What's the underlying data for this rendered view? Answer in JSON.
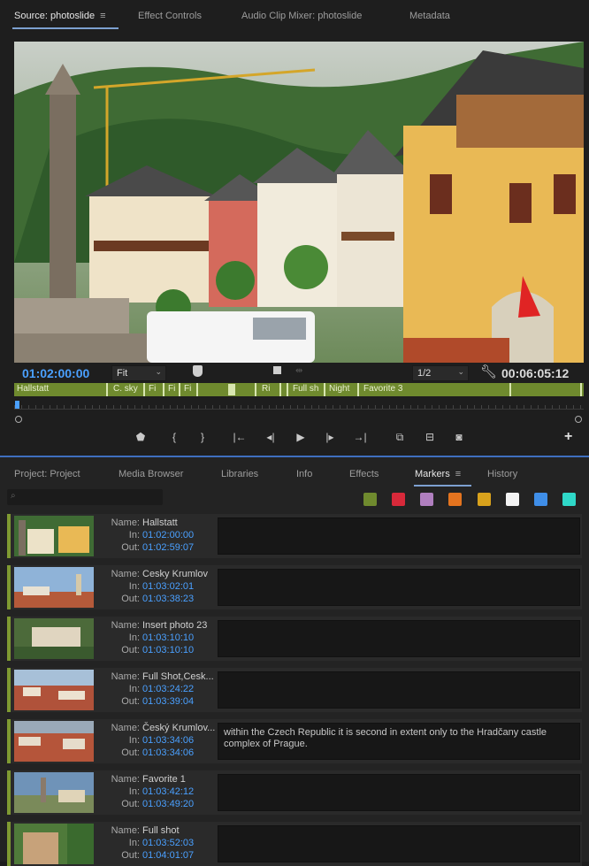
{
  "source_tabs": [
    {
      "label": "Source: photoslide",
      "active": true
    },
    {
      "label": "Effect Controls"
    },
    {
      "label": "Audio Clip Mixer: photoslide"
    },
    {
      "label": "Metadata"
    }
  ],
  "monitor": {
    "current_timecode": "01:02:00:00",
    "zoom": "Fit",
    "resolution": "1/2",
    "duration_timecode": "00:06:05:12"
  },
  "clip_markers": [
    "Hallstatt",
    "C. sky",
    "Fi",
    "Fi",
    "Fi",
    "Ri",
    "Full sh",
    "Night",
    "Favorite 3"
  ],
  "project_tabs": [
    {
      "label": "Project: Project"
    },
    {
      "label": "Media Browser"
    },
    {
      "label": "Libraries"
    },
    {
      "label": "Info"
    },
    {
      "label": "Effects"
    },
    {
      "label": "Markers",
      "active": true
    },
    {
      "label": "History"
    }
  ],
  "marker_colors": [
    "#6f8a2e",
    "#d8293a",
    "#b07fbf",
    "#e4741f",
    "#d9a21c",
    "#f2f2f2",
    "#3f8ee8",
    "#2fd8c8"
  ],
  "labels": {
    "name": "Name:",
    "in": "In:",
    "out": "Out:"
  },
  "markers": [
    {
      "name": "Hallstatt",
      "in": "01:02:00:00",
      "out": "01:02:59:07",
      "comment": ""
    },
    {
      "name": "Cesky Krumlov",
      "in": "01:03:02:01",
      "out": "01:03:38:23",
      "comment": ""
    },
    {
      "name": "Insert photo 23",
      "in": "01:03:10:10",
      "out": "01:03:10:10",
      "comment": ""
    },
    {
      "name": "Full Shot,Cesk...",
      "in": "01:03:24:22",
      "out": "01:03:39:04",
      "comment": ""
    },
    {
      "name": "Český Krumlov...",
      "in": "01:03:34:06",
      "out": "01:03:34:06",
      "comment": "within the Czech Republic it is second in extent only to the Hradčany castle complex of Prague."
    },
    {
      "name": "Favorite 1",
      "in": "01:03:42:12",
      "out": "01:03:49:20",
      "comment": ""
    },
    {
      "name": "Full shot",
      "in": "01:03:52:03",
      "out": "01:04:01:07",
      "comment": ""
    }
  ]
}
